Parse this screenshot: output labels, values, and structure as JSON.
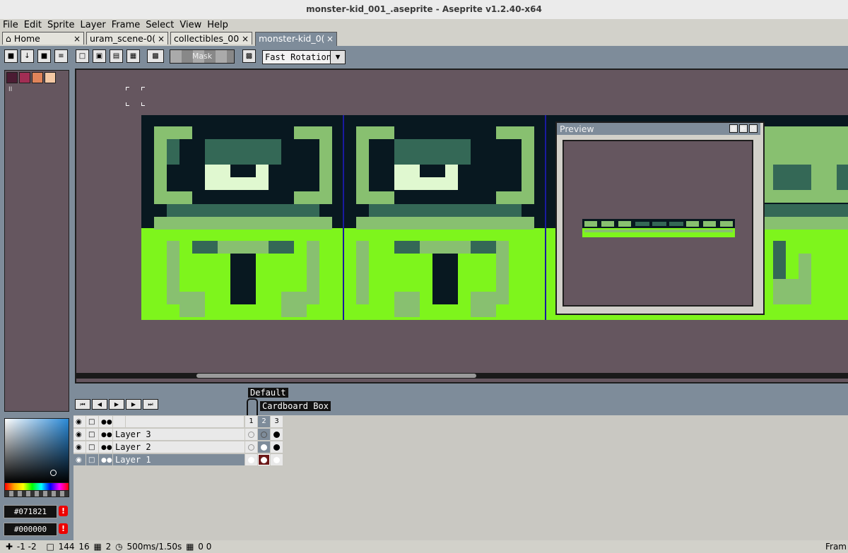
{
  "window": {
    "title": "monster-kid_001_.aseprite - Aseprite v1.2.40-x64"
  },
  "menu": [
    "File",
    "Edit",
    "Sprite",
    "Layer",
    "Frame",
    "Select",
    "View",
    "Help"
  ],
  "tabs": [
    {
      "label": "Home",
      "close": "×"
    },
    {
      "label": "uram_scene-0(",
      "close": "×"
    },
    {
      "label": "collectibles_00",
      "close": "×"
    },
    {
      "label": "monster-kid_0(",
      "close": "×"
    }
  ],
  "toolbar": {
    "mask_label": "Mask",
    "rotation_algorithm": "Fast Rotation",
    "icons": [
      "lock-icon",
      "arrow-down-icon",
      "stop-icon",
      "menu-icon",
      "select-replace-icon",
      "select-add-icon",
      "select-subtract-icon",
      "select-intersect-icon",
      "auto-align-icon",
      "pivot-icon"
    ]
  },
  "palette": {
    "colors": [
      "#4b1c33",
      "#a22d54",
      "#e0845a",
      "#f4c8a4"
    ],
    "indicator": "II"
  },
  "colors": {
    "foreground_hex": "#071821",
    "background_hex": "#000000",
    "warning": "!"
  },
  "preview": {
    "title": "Preview"
  },
  "timeline": {
    "tags": {
      "default_tag": "Default",
      "box_tag": "Cardboard Box"
    },
    "frames": [
      "1",
      "2",
      "3"
    ],
    "layers": [
      {
        "name": "Layer 3",
        "selected": false
      },
      {
        "name": "Layer 2",
        "selected": false
      },
      {
        "name": "Layer 1",
        "selected": true
      }
    ]
  },
  "status": {
    "cursor": "-1 -2",
    "size_w": "144",
    "size_h": "16",
    "frames": "2",
    "duration": "500ms/1.50s",
    "grid": "0 0",
    "right_label": "Fram"
  }
}
